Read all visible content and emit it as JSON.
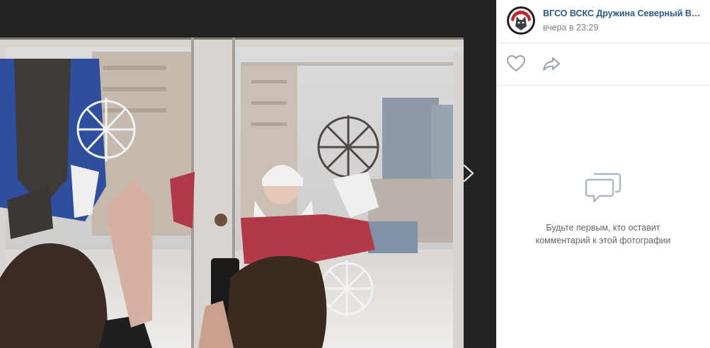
{
  "post": {
    "author": "ВГСО ВСКС Дружина Северный Во...",
    "time": "вчера в 23:29"
  },
  "icons": {
    "avatar": "group-avatar-wolf-emblem",
    "like": "heart-icon",
    "share": "share-arrow-icon",
    "next": "chevron-right-icon",
    "comments": "chat-bubbles-icon"
  },
  "comments": {
    "empty_line1": "Будьте первым, кто оставит",
    "empty_line2": "комментарий к этой фотографии"
  },
  "colors": {
    "link": "#2a5885",
    "muted": "#828282",
    "icon": "#99a2ad",
    "viewer_bg": "#222222"
  }
}
